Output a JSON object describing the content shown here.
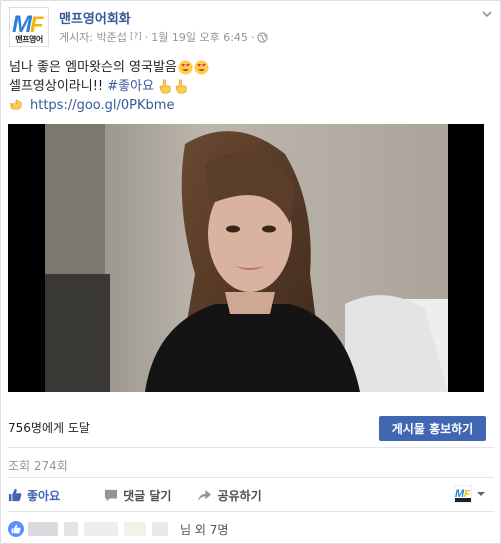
{
  "post": {
    "page_name": "맨프영어회화",
    "meta": {
      "author": "게시자: 박준섭",
      "question_mark": "[?]",
      "separator": "·",
      "timestamp": "1월 19일 오후 6:45",
      "separator2": "·"
    },
    "text": {
      "line1": "넘나 좋은 엠마왓슨의 영국발음",
      "line2_prefix": "셀프영상이라니!! ",
      "line2_hashtag": "#좋아요",
      "line3_link": "https://goo.gl/0PKbme"
    },
    "avatar_label": "맨프영어"
  },
  "stats": {
    "reach": "756명에게 도달",
    "boost_button": "게시물 홍보하기",
    "views": "조회 274회"
  },
  "actions": {
    "like": "좋아요",
    "comment": "댓글 달기",
    "share": "공유하기"
  },
  "reactions": {
    "others": "님 외 7명"
  },
  "colors": {
    "link": "#365899",
    "button": "#4267b2",
    "meta_gray": "#90949c"
  }
}
